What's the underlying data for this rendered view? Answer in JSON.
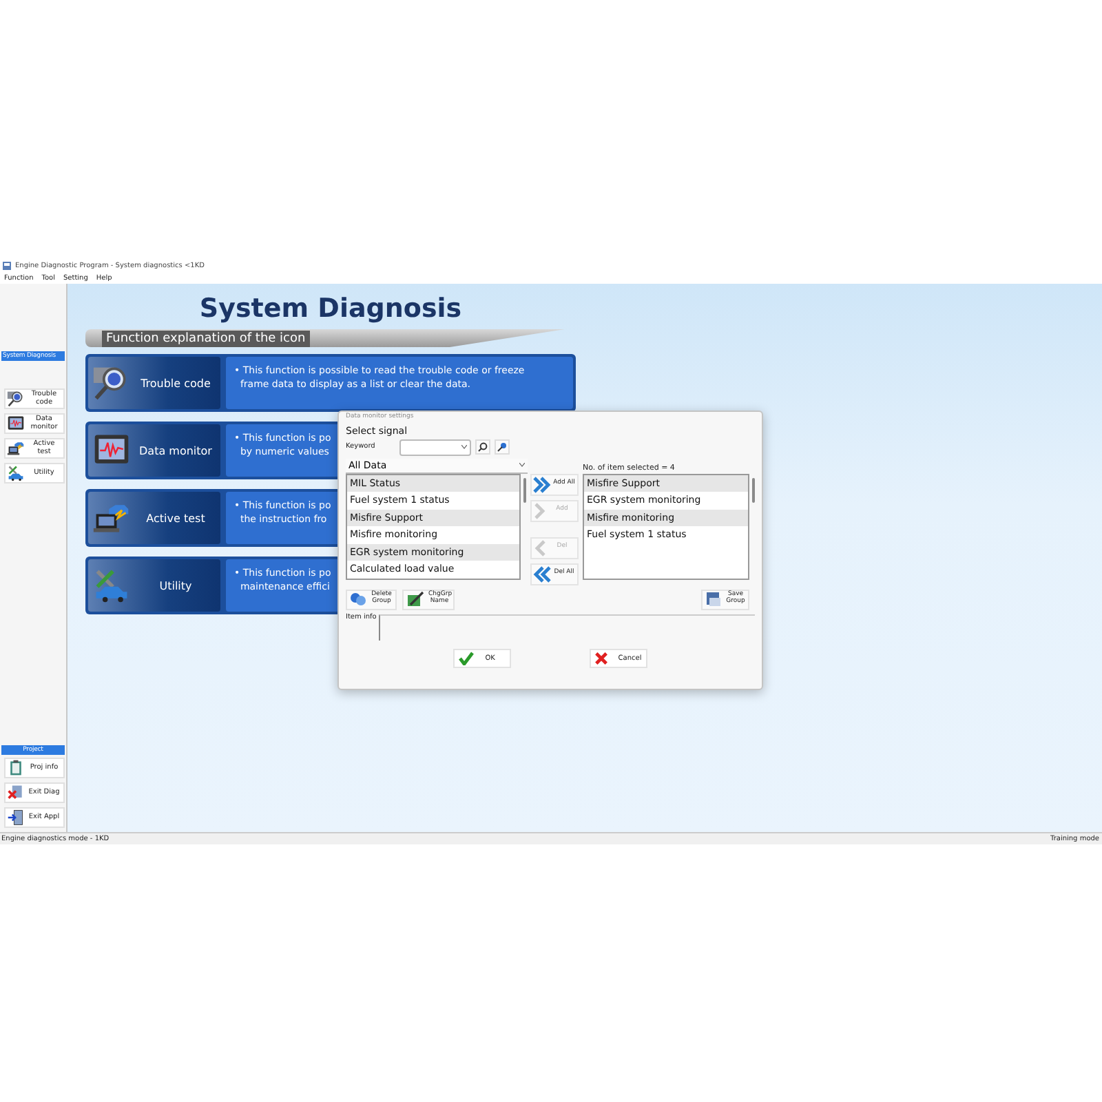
{
  "window": {
    "title": "Engine Diagnostic Program - System diagnostics <1KD"
  },
  "menu": [
    "Function",
    "Tool",
    "Setting",
    "Help"
  ],
  "sidebar": {
    "header": "System Diagnosis",
    "items": [
      {
        "label": "Trouble code",
        "kind": "dtc"
      },
      {
        "label": "Data monitor",
        "kind": "monitor"
      },
      {
        "label": "Active test",
        "kind": "active"
      },
      {
        "label": "Utility",
        "kind": "utility"
      }
    ],
    "project_header": "Project",
    "project_items": [
      {
        "label": "Proj info",
        "kind": "info"
      },
      {
        "label": "Exit Diag",
        "kind": "exit"
      },
      {
        "label": "Exit Appl",
        "kind": "appl"
      }
    ]
  },
  "page": {
    "title": "System Diagnosis",
    "section": "Function explanation of the icon",
    "functions": [
      {
        "label": "Trouble code",
        "kind": "dtc",
        "description": [
          "• This function is possible to read the trouble code or freeze",
          "frame data to display as a list or clear the data."
        ]
      },
      {
        "label": "Data monitor",
        "kind": "monitor",
        "description": [
          "• This function is po",
          "by numeric values"
        ]
      },
      {
        "label": "Active test",
        "kind": "active",
        "description": [
          "• This function is po",
          "the instruction fro"
        ]
      },
      {
        "label": "Utility",
        "kind": "utility",
        "description": [
          "• This function is po",
          "maintenance effici"
        ]
      }
    ]
  },
  "dialog": {
    "title": "Data monitor settings",
    "heading": "Select signal",
    "keyword_label": "Keyword",
    "category": "All Data",
    "available": [
      "MIL Status",
      "Fuel system 1 status",
      "Misfire Support",
      "Misfire monitoring",
      "EGR system monitoring",
      "Calculated load value"
    ],
    "selected_count": "No. of item selected = 4",
    "selected_items": [
      "Misfire Support",
      "EGR system monitoring",
      "Misfire monitoring",
      "Fuel system 1 status"
    ],
    "transfer_buttons": [
      {
        "label": "Add All",
        "kind": "add_all",
        "disabled": false
      },
      {
        "label": "Add",
        "kind": "add",
        "disabled": true
      },
      {
        "label": "Del",
        "kind": "del",
        "disabled": true
      },
      {
        "label": "Del All",
        "kind": "del_all",
        "disabled": false
      }
    ],
    "group_buttons": [
      {
        "label": "Delete Group",
        "kind": "delete"
      },
      {
        "label": "ChgGrp Name",
        "kind": "rename"
      }
    ],
    "save_button": "Save Group",
    "item_info_label": "Item info",
    "buttons": [
      {
        "label": "OK",
        "kind": "ok"
      },
      {
        "label": "Cancel",
        "kind": "cancel"
      }
    ]
  },
  "status_bar": {
    "left": "Engine diagnostics mode - 1KD",
    "right": "Training mode"
  }
}
